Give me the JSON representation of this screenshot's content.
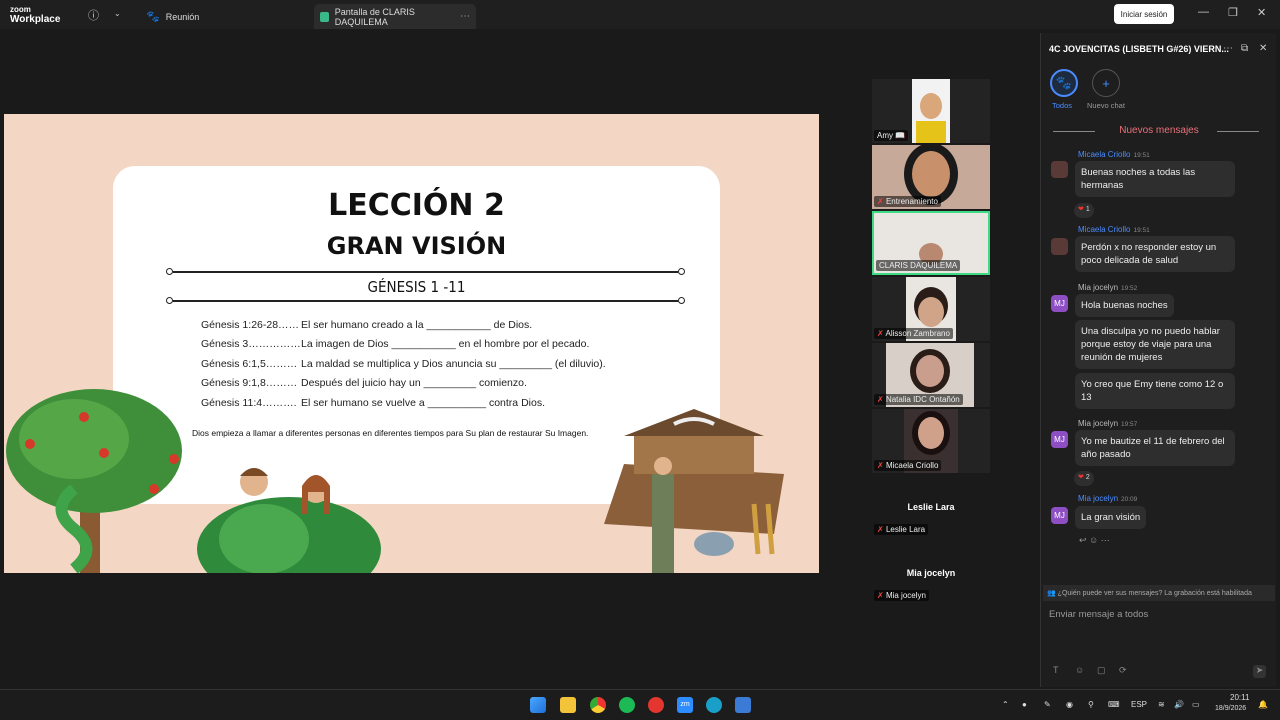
{
  "topbar": {
    "logo_line1": "zoom",
    "logo_line2": "Workplace",
    "tab_meeting": "Reunión",
    "tab_share": "Pantalla de CLARIS DAQUILEMA",
    "signin_label": "Iniciar sesión"
  },
  "slide": {
    "title": "LECCIÓN 2",
    "subtitle": "GRAN VISIÓN",
    "reference": "GÉNESIS 1 -11",
    "verses": [
      {
        "ref": "Génesis 1:26-28……",
        "text": "El ser humano creado a la ___________ de Dios."
      },
      {
        "ref": "Génesis 3……………",
        "text": "La imagen de Dios ___________ en el hombre por el pecado."
      },
      {
        "ref": "Génesis 6:1,5………",
        "text": "La maldad se multiplica y Dios anuncia su _________ (el diluvio)."
      },
      {
        "ref": "Génesis 9:1,8………",
        "text": "Después del juicio hay un _________ comienzo."
      },
      {
        "ref": "Génesis 11:4……….",
        "text": "El ser humano se vuelve a __________ contra Dios."
      }
    ],
    "summary": "Dios empieza a llamar a diferentes personas en diferentes tiempos para Su plan de restaurar Su Imagen."
  },
  "participants": [
    {
      "name": "Amy 📖",
      "skin": "#d9a77a",
      "bg": "#f2f2f2"
    },
    {
      "name": "Entrenamiento",
      "skin": "#c9906c",
      "bg": "#c7a99a"
    },
    {
      "name": "CLARIS DAQUILEMA",
      "skin": "#b88970",
      "bg": "#e9e5e0"
    },
    {
      "name": "Alisson Zambrano",
      "skin": "#d0a488",
      "bg": "#e9e6e1"
    },
    {
      "name": "Natalia IDC Ontañón",
      "skin": "#c99e8d",
      "bg": "#d8d0c8"
    },
    {
      "name": "Micaela Criollo",
      "skin": "#cfa18a",
      "bg": "#3a3030"
    },
    {
      "name": "Leslie Lara"
    },
    {
      "name": "Mia jocelyn"
    }
  ],
  "chat": {
    "title": "4C JOVENCITAS (LISBETH G#26) VIERN...",
    "filter_all": "Todos",
    "new_chat": "Nuevo chat",
    "new_messages": "Nuevos mensajes",
    "messages": [
      {
        "sender": "Micaela Criollo",
        "time": "19:51",
        "text": "Buenas noches a todas las hermanas",
        "reaction": "1"
      },
      {
        "sender": "Micaela Criollo",
        "time": "19:51",
        "text": "Perdón x no responder estoy un poco delicada de salud"
      },
      {
        "sender": "Mia jocelyn",
        "time": "19:52",
        "text": "Hola buenas noches"
      },
      {
        "text": "Una disculpa yo no puedo hablar porque estoy de viaje para una reunión de mujeres"
      },
      {
        "text": "Yo creo que Emy tiene como 12 o 13"
      },
      {
        "sender": "Mia jocelyn",
        "time": "19:57",
        "text": "Yo me bautize el 11 de febrero del año pasado",
        "reaction": "2"
      },
      {
        "sender": "Mia jocelyn",
        "time": "20:09",
        "text": "La gran visión"
      }
    ],
    "avatar_initials": "MJ",
    "privacy_note": "¿Quién puede ver sus mensajes? La grabación está habilitada",
    "input_placeholder": "Enviar mensaje a todos"
  },
  "taskbar": {
    "lang": "ESP",
    "time": "20:11",
    "date": "18/9/2026"
  },
  "colors": {
    "accent": "#4a8cff",
    "active_speaker": "#3ddc84",
    "mj_avatar": "#8e4fc4"
  }
}
